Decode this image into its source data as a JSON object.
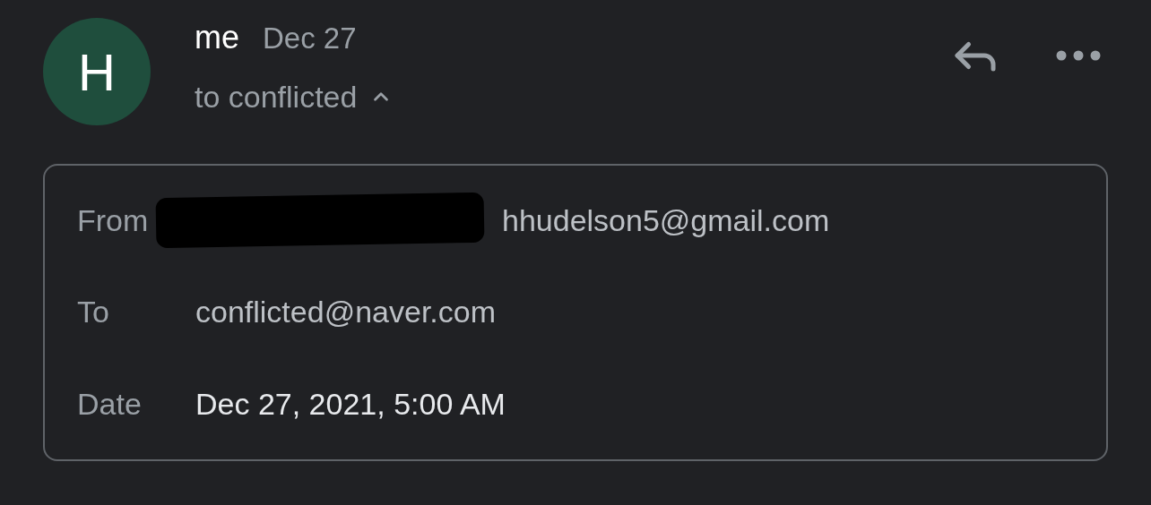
{
  "sender": {
    "avatar_letter": "H",
    "name": "me",
    "date": "Dec 27",
    "recipient_line": "to conflicted",
    "expanded": true
  },
  "details": [
    {
      "label": "From",
      "value": "hhudelson5@gmail.com",
      "redacted": true
    },
    {
      "label": "To",
      "value": "conflicted@naver.com",
      "redacted": false
    },
    {
      "label": "Date",
      "value": "Dec 27, 2021, 5:00 AM",
      "redacted": false
    }
  ]
}
